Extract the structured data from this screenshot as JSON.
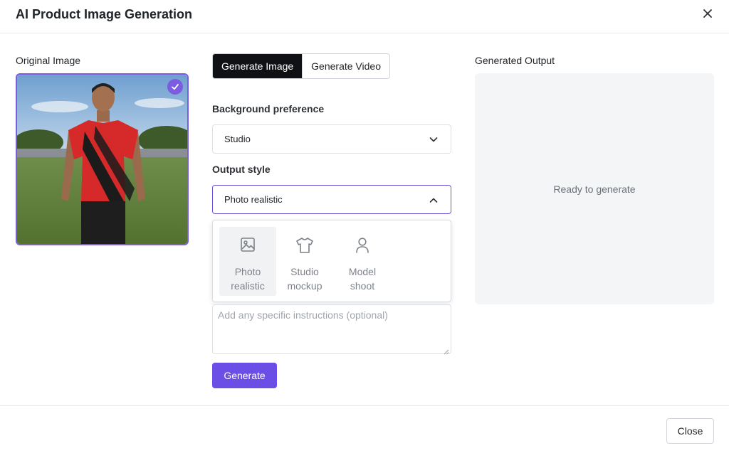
{
  "header": {
    "title": "AI Product Image Generation",
    "close_icon": "close-icon"
  },
  "original": {
    "label": "Original Image",
    "selected_icon": "checkmark-icon"
  },
  "tabs": [
    {
      "label": "Generate Image",
      "active": true
    },
    {
      "label": "Generate Video",
      "active": false
    }
  ],
  "background": {
    "label": "Background preference",
    "value": "Studio",
    "icon": "chevron-down-icon"
  },
  "style": {
    "label": "Output style",
    "value": "Photo realistic",
    "icon": "chevron-up-icon",
    "options": [
      {
        "line1": "Photo",
        "line2": "realistic",
        "icon": "image-icon",
        "selected": true
      },
      {
        "line1": "Studio",
        "line2": "mockup",
        "icon": "tshirt-icon",
        "selected": false
      },
      {
        "line1": "Model",
        "line2": "shoot",
        "icon": "person-icon",
        "selected": false
      }
    ]
  },
  "instructions": {
    "placeholder": "Add any specific instructions (optional)",
    "value": ""
  },
  "generate_label": "Generate",
  "output": {
    "label": "Generated Output",
    "status": "Ready to generate"
  },
  "footer": {
    "close_label": "Close"
  },
  "colors": {
    "accent": "#6b4ee6",
    "tab_active_bg": "#0f1115",
    "output_bg": "#f3f5f7"
  }
}
